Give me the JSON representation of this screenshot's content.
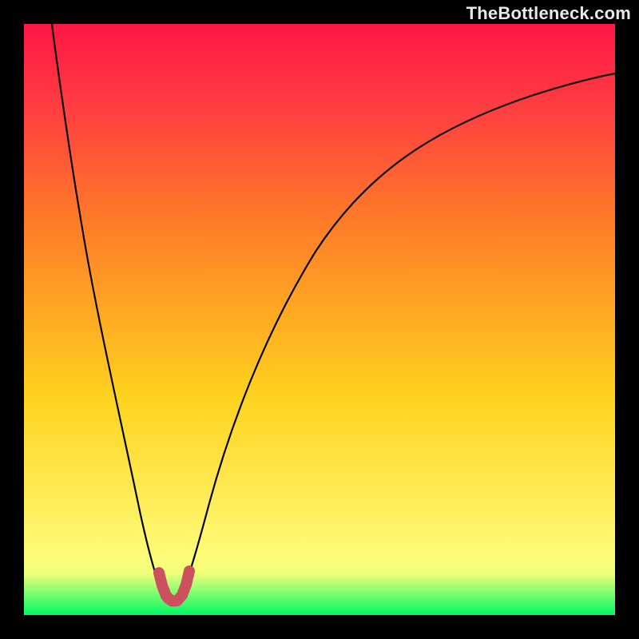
{
  "watermark": "TheBottleneck.com",
  "colors": {
    "frame": "#000000",
    "gradient_top": "#ff1646",
    "gradient_upper_mid": "#ff7a28",
    "gradient_mid": "#ffd21e",
    "gradient_lower_mid": "#fffb78",
    "gradient_bottom": "#00fb64",
    "curve": "#050505",
    "highlight": "#cd505f"
  },
  "chart_data": {
    "type": "line",
    "description": "Bottleneck percentage vs. a hardware-balance axis. The black curve drops steeply from the top-left, reaches a narrow minimum (near-zero bottleneck, highlighted in red) at roughly 25% along the x-axis, then rises more gradually toward the right. Background heat gradient encodes bottleneck severity from green (0%) at the bottom to red (100%) at the top.",
    "x_range": [
      0,
      100
    ],
    "y_range": [
      0,
      100
    ],
    "x": [
      5,
      8,
      12,
      17,
      22,
      24,
      25,
      26,
      28,
      31,
      37,
      46,
      58,
      72,
      86,
      100
    ],
    "series": [
      {
        "name": "bottleneck_pct",
        "values": [
          100,
          90,
          66,
          35,
          12,
          3,
          1,
          3,
          9,
          20,
          37,
          55,
          69,
          78,
          84,
          88
        ]
      }
    ],
    "optimal_x": 25,
    "optimal_y": 1,
    "xlabel": "",
    "ylabel": "",
    "title": ""
  }
}
